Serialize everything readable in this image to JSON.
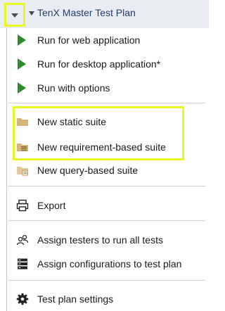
{
  "header": {
    "plan_title": "TenX Master Test Plan"
  },
  "menu": {
    "run_web": "Run for web application",
    "run_desktop": "Run for desktop application*",
    "run_options": "Run with options",
    "new_static_suite": "New static suite",
    "new_requirement_suite": "New requirement-based suite",
    "new_query_suite": "New query-based suite",
    "export": "Export",
    "assign_testers": "Assign testers to run all tests",
    "assign_configs": "Assign configurations to test plan",
    "settings": "Test plan settings"
  },
  "colors": {
    "highlight": "#eaf623",
    "play": "#2e8b2e",
    "folder": "#d7b47a"
  }
}
